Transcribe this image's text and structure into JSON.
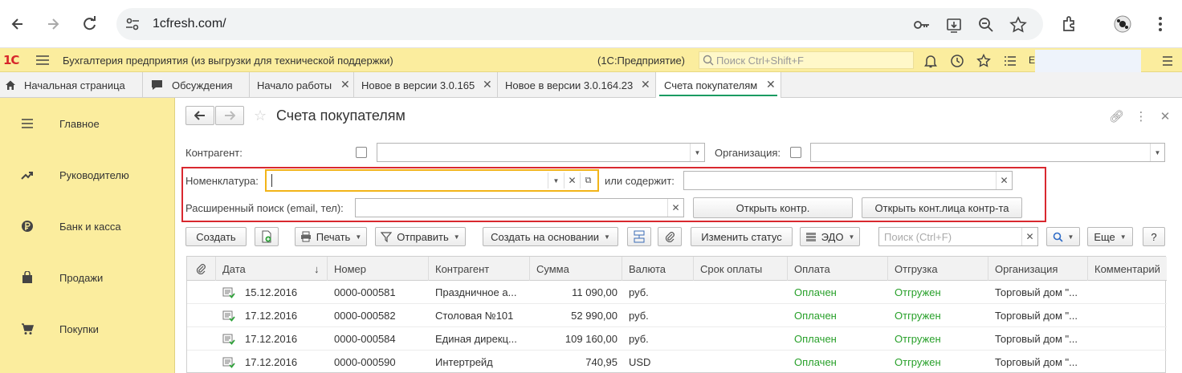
{
  "browser": {
    "url": "1cfresh.com/"
  },
  "app": {
    "logo": "1С",
    "title": "Бухгалтерия предприятия (из выгрузки для технической поддержки)",
    "platform": "(1С:Предприятие)",
    "search_placeholder": "Поиск Ctrl+Shift+F",
    "user_initial": "E"
  },
  "tabs": [
    {
      "label": "Начальная страница"
    },
    {
      "label": "Обсуждения"
    },
    {
      "label": "Начало работы"
    },
    {
      "label": "Новое в версии 3.0.165"
    },
    {
      "label": "Новое в версии 3.0.164.23"
    },
    {
      "label": "Счета покупателям"
    }
  ],
  "sidebar": {
    "items": [
      {
        "label": "Главное",
        "icon": "menu-icon"
      },
      {
        "label": "Руководителю",
        "icon": "trend-icon"
      },
      {
        "label": "Банк и касса",
        "icon": "ruble-coin-icon"
      },
      {
        "label": "Продажи",
        "icon": "shopping-bag-icon"
      },
      {
        "label": "Покупки",
        "icon": "cart-icon"
      }
    ]
  },
  "form": {
    "title": "Счета покупателям",
    "filters": {
      "counterparty_label": "Контрагент:",
      "counterparty_value": "",
      "organization_label": "Организация:",
      "organization_value": "",
      "nomenclature_label": "Номенклатура:",
      "nomenclature_value": "",
      "contains_label": "или содержит:",
      "contains_value": "",
      "extended_label": "Расширенный поиск (email, тел):",
      "extended_value": "",
      "open_contr": "Открыть контр.",
      "open_contact": "Открыть конт.лица контр-та"
    },
    "toolbar": {
      "create": "Создать",
      "print": "Печать",
      "send": "Отправить",
      "create_based": "Создать на основании",
      "change_status": "Изменить статус",
      "edo": "ЭДО",
      "search_placeholder": "Поиск (Ctrl+F)",
      "more": "Еще",
      "help": "?"
    },
    "table": {
      "columns": [
        "Дата",
        "Номер",
        "Контрагент",
        "Сумма",
        "Валюта",
        "Срок оплаты",
        "Оплата",
        "Отгрузка",
        "Организация",
        "Комментарий"
      ],
      "sort_indicator": "↓",
      "rows": [
        {
          "date": "15.12.2016",
          "number": "0000-000581",
          "counterparty": "Праздничное а...",
          "sum": "11 090,00",
          "currency": "руб.",
          "due": "",
          "payment": "Оплачен",
          "shipment": "Отгружен",
          "org": "Торговый дом \"...",
          "comment": ""
        },
        {
          "date": "17.12.2016",
          "number": "0000-000582",
          "counterparty": "Столовая №101",
          "sum": "52 990,00",
          "currency": "руб.",
          "due": "",
          "payment": "Оплачен",
          "shipment": "Отгружен",
          "org": "Торговый дом \"...",
          "comment": ""
        },
        {
          "date": "17.12.2016",
          "number": "0000-000584",
          "counterparty": "Единая дирекц...",
          "sum": "109 160,00",
          "currency": "руб.",
          "due": "",
          "payment": "Оплачен",
          "shipment": "Отгружен",
          "org": "Торговый дом \"...",
          "comment": ""
        },
        {
          "date": "17.12.2016",
          "number": "0000-000590",
          "counterparty": "Интертрейд",
          "sum": "740,95",
          "currency": "USD",
          "due": "",
          "payment": "Оплачен",
          "shipment": "Отгружен",
          "org": "Торговый дом \"...",
          "comment": ""
        }
      ]
    }
  },
  "colors": {
    "accent_yellow": "#fbed9e",
    "status_green": "#28a02a",
    "highlight_red": "#d9282f",
    "focus_orange": "#f2b418"
  }
}
